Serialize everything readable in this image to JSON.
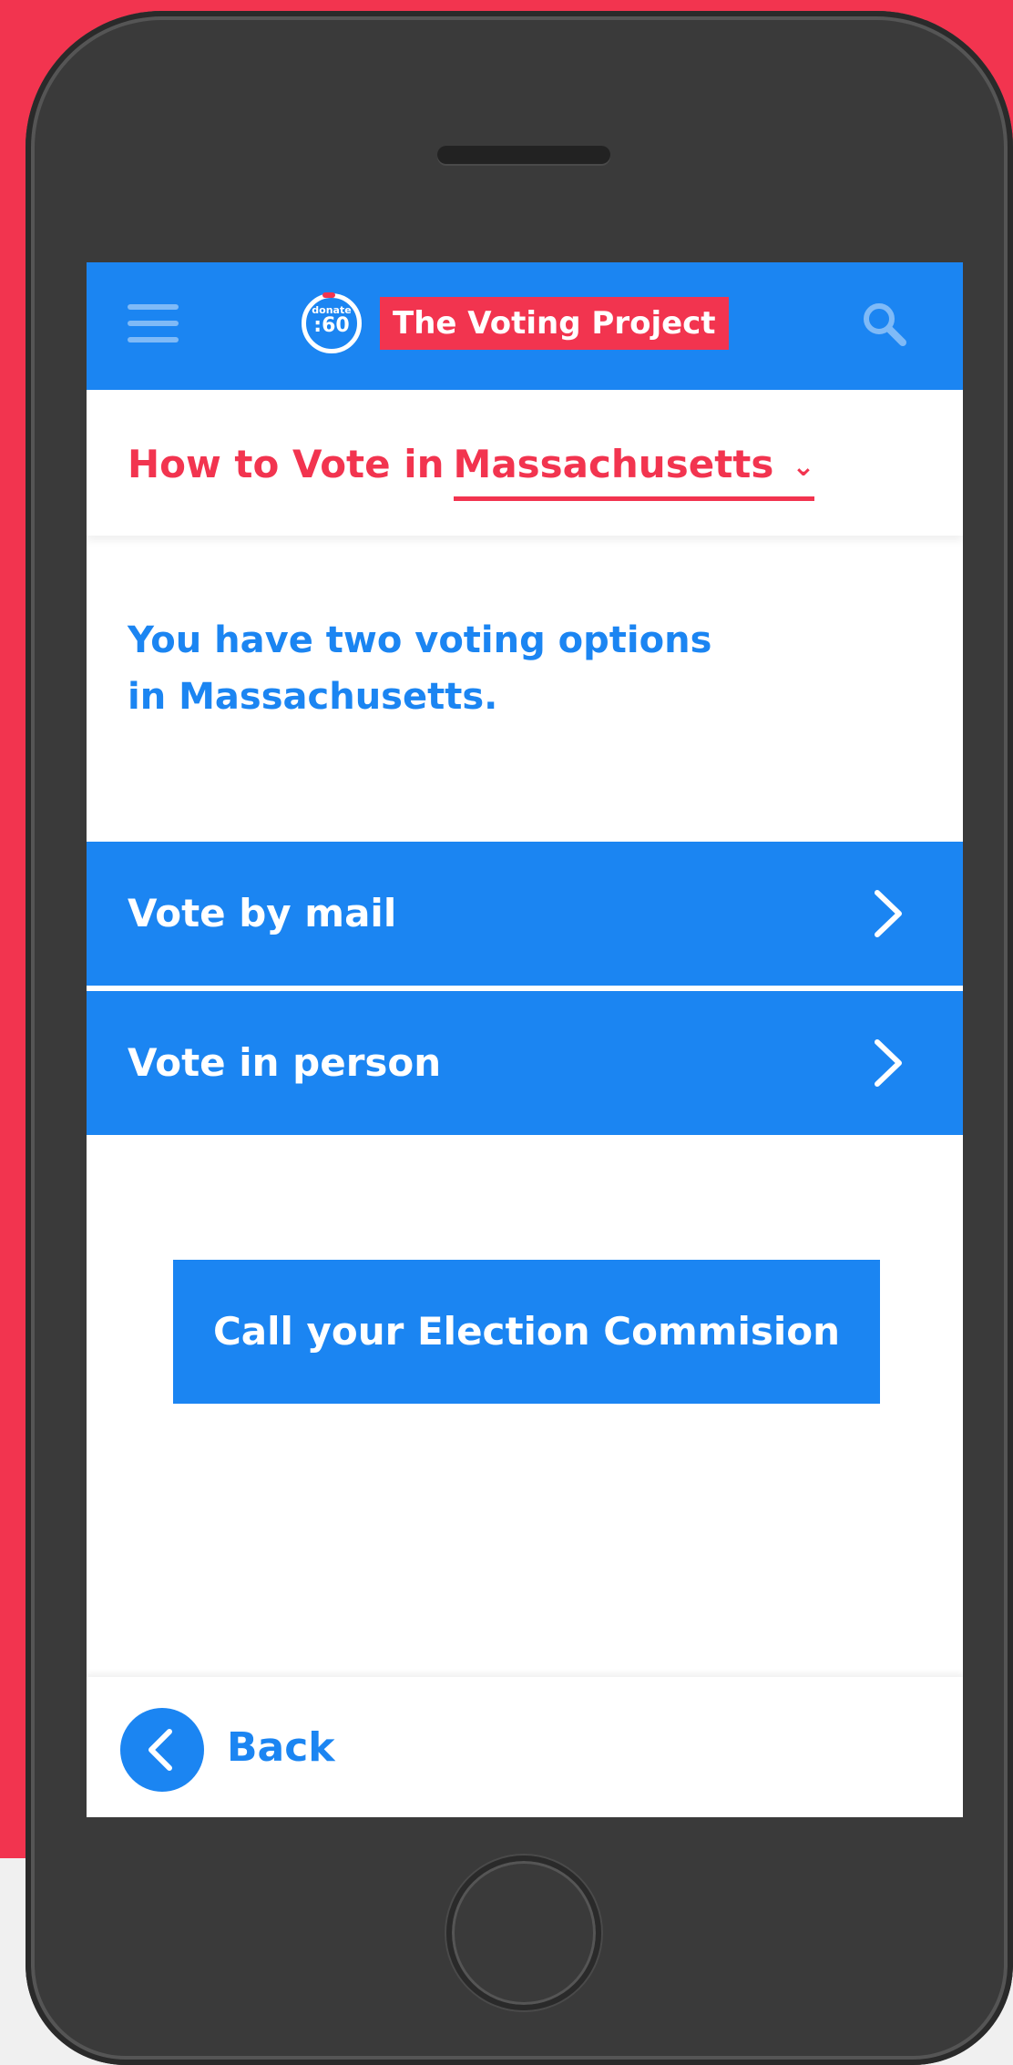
{
  "header": {
    "logo_small": "donate",
    "logo_big": ":60",
    "title": "The Voting Project"
  },
  "state_bar": {
    "prefix": "How to Vote in",
    "selected_state": "Massachusetts",
    "dropdown_glyph": "⌄"
  },
  "intro": {
    "line1": "You have two voting options",
    "line2": "in Massachusetts."
  },
  "options": [
    {
      "label": "Vote by mail"
    },
    {
      "label": "Vote in person"
    }
  ],
  "call_button": {
    "label": "Call your Election Commision"
  },
  "footer": {
    "back_label": "Back"
  },
  "colors": {
    "accent_blue": "#1b85f2",
    "accent_red": "#f2344f",
    "phone_body": "#3a3a3a"
  },
  "icons": [
    "menu-icon",
    "search-icon",
    "chevron-down-icon",
    "chevron-right-icon",
    "chevron-left-icon"
  ]
}
